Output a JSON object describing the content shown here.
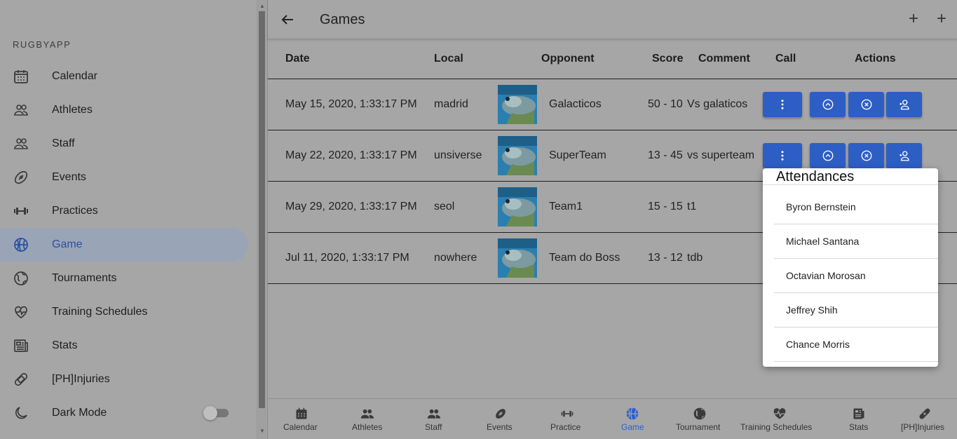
{
  "sidebar": {
    "app_name": "RUGBYAPP",
    "items": [
      {
        "label": "Calendar",
        "icon": "calendar-icon"
      },
      {
        "label": "Athletes",
        "icon": "people-icon"
      },
      {
        "label": "Staff",
        "icon": "people-icon"
      },
      {
        "label": "Events",
        "icon": "football-icon"
      },
      {
        "label": "Practices",
        "icon": "dumbbell-icon"
      },
      {
        "label": "Game",
        "icon": "basketball-icon",
        "active": true
      },
      {
        "label": "Tournaments",
        "icon": "globe-icon"
      },
      {
        "label": "Training Schedules",
        "icon": "heartbeat-icon"
      },
      {
        "label": "Stats",
        "icon": "newspaper-icon"
      },
      {
        "label": "[PH]Injuries",
        "icon": "bandage-icon"
      },
      {
        "label": "Dark Mode",
        "icon": "moon-icon",
        "toggle": false
      }
    ]
  },
  "header": {
    "title": "Games"
  },
  "table": {
    "columns": [
      "Date",
      "Local",
      "Opponent",
      "Score",
      "Comment",
      "Call",
      "Actions"
    ],
    "rows": [
      {
        "date": "May 15, 2020, 1:33:17 PM",
        "local": "madrid",
        "opponent": "Galacticos",
        "score": "50 - 10",
        "comment": "Vs galaticos"
      },
      {
        "date": "May 22, 2020, 1:33:17 PM",
        "local": "unsiverse",
        "opponent": "SuperTeam",
        "score": "13 - 45",
        "comment": "vs superteam"
      },
      {
        "date": "May 29, 2020, 1:33:17 PM",
        "local": "seol",
        "opponent": "Team1",
        "score": "15 - 15",
        "comment": "t1"
      },
      {
        "date": "Jul 11, 2020, 1:33:17 PM",
        "local": "nowhere",
        "opponent": "Team do Boss",
        "score": "13 - 12",
        "comment": "tdb"
      }
    ]
  },
  "attendances": {
    "title": "Attendances",
    "people": [
      "Byron Bernstein",
      "Michael Santana",
      "Octavian Morosan",
      "Jeffrey Shih",
      "Chance Morris"
    ]
  },
  "bottom_nav": [
    {
      "label": "Calendar",
      "icon": "calendar-icon"
    },
    {
      "label": "Athletes",
      "icon": "people-icon"
    },
    {
      "label": "Staff",
      "icon": "people-icon"
    },
    {
      "label": "Events",
      "icon": "football-icon"
    },
    {
      "label": "Practice",
      "icon": "dumbbell-icon"
    },
    {
      "label": "Game",
      "icon": "basketball-icon",
      "active": true
    },
    {
      "label": "Tournament",
      "icon": "globe-icon"
    },
    {
      "label": "Training Schedules",
      "icon": "heartbeat-icon"
    },
    {
      "label": "Stats",
      "icon": "newspaper-icon"
    },
    {
      "label": "[PH]Injuries",
      "icon": "bandage-icon"
    }
  ],
  "colors": {
    "accent": "#2d5ec4",
    "overlay_bg": "#a6a6a6",
    "active_item_bg": "#9aa4b7"
  }
}
